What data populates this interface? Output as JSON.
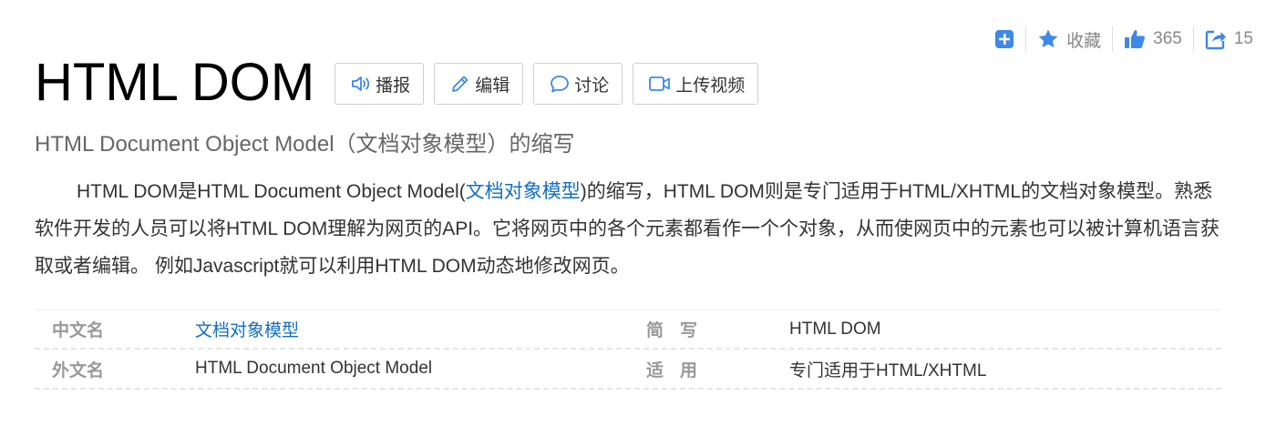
{
  "toolbar": {
    "favorite_label": "收藏",
    "like_count": "365",
    "share_count": "15",
    "icon_color": "#3e89e6"
  },
  "title": "HTML DOM",
  "actions": {
    "broadcast": "播报",
    "edit": "编辑",
    "discuss": "讨论",
    "upload_video": "上传视频"
  },
  "subtitle": "HTML Document Object Model（文档对象模型）的缩写",
  "summary": {
    "part1": "HTML DOM是HTML Document Object Model(",
    "link": "文档对象模型",
    "part2": ")的缩写，HTML DOM则是专门适用于HTML/XHTML的文档对象模型。熟悉软件开发的人员可以将HTML DOM理解为网页的API。它将网页中的各个元素都看作一个个对象，从而使网页中的元素也可以被计算机语言获取或者编辑。 例如Javascript就可以利用HTML DOM动态地修改网页。"
  },
  "basic_info": [
    {
      "key1": "中文名",
      "value1": "文档对象模型",
      "key2": "简写",
      "value2": "HTML DOM"
    },
    {
      "key1": "外文名",
      "value1": "HTML Document Object Model",
      "key2": "适用",
      "value2": "专门适用于HTML/XHTML"
    }
  ],
  "colors": {
    "link": "#136ec2",
    "accent_icon": "#3e89e6"
  }
}
